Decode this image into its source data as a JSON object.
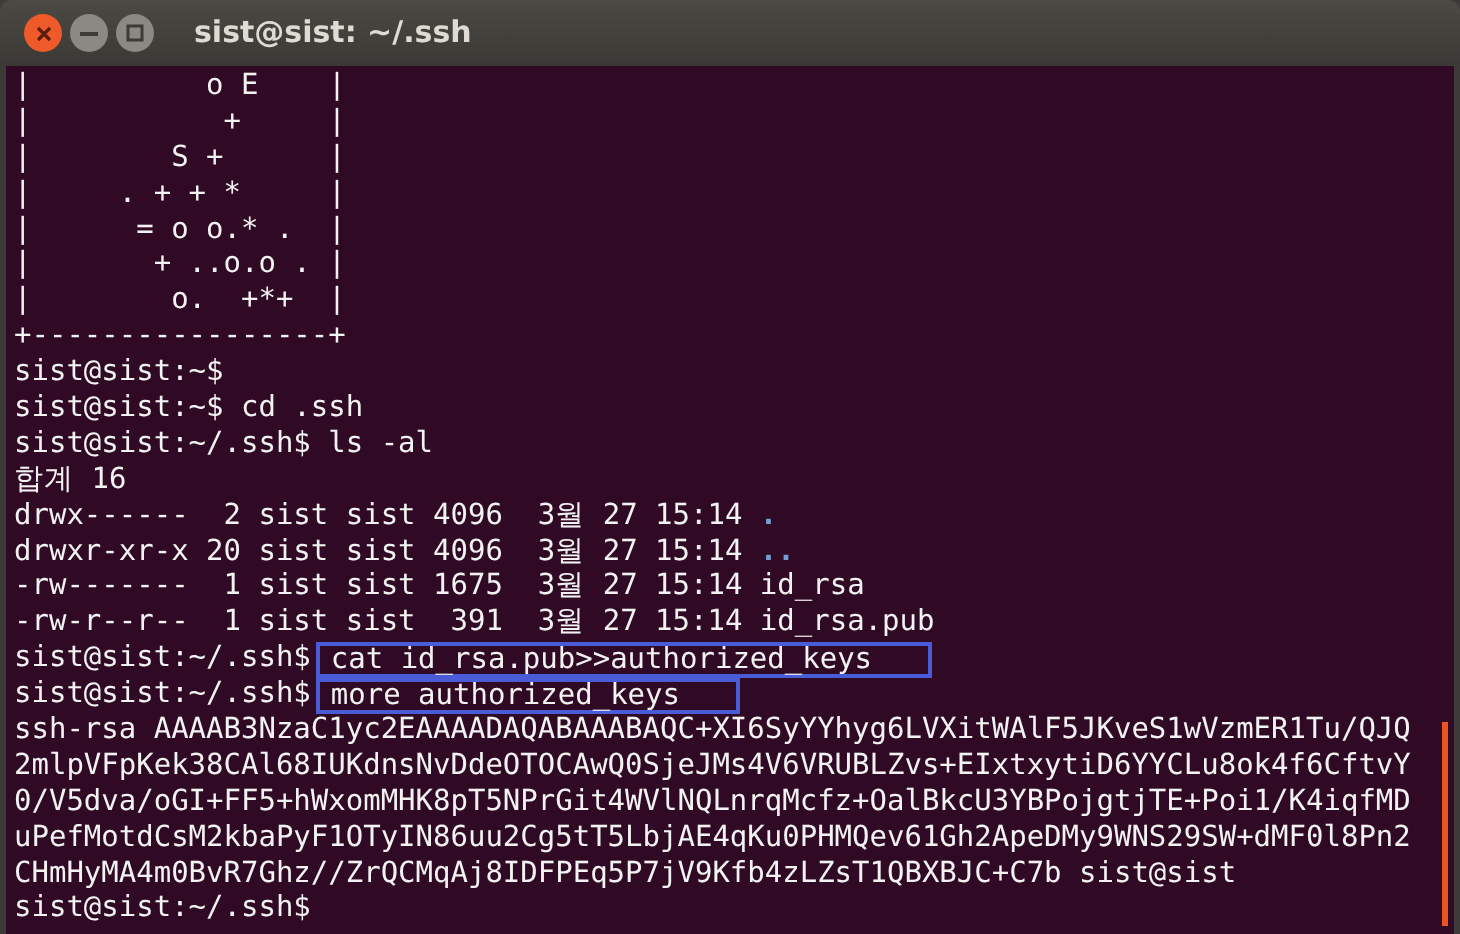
{
  "window": {
    "title": "sist@sist: ~/.ssh"
  },
  "terminal": {
    "lines": [
      {
        "kind": "text",
        "text": "|          o E    |"
      },
      {
        "kind": "text",
        "text": "|           +     |"
      },
      {
        "kind": "text",
        "text": "|        S +      |"
      },
      {
        "kind": "text",
        "text": "|     . + + *     |"
      },
      {
        "kind": "text",
        "text": "|      = o o.* .  |"
      },
      {
        "kind": "text",
        "text": "|       + ..o.o . |"
      },
      {
        "kind": "text",
        "text": "|        o.  +*+  |"
      },
      {
        "kind": "text",
        "text": "+-----------------+"
      },
      {
        "kind": "prompt",
        "prompt": "sist@sist:~$"
      },
      {
        "kind": "prompt",
        "prompt": "sist@sist:~$",
        "command": "cd .ssh",
        "highlighted": false
      },
      {
        "kind": "prompt",
        "prompt": "sist@sist:~/.ssh$",
        "command": "ls -al",
        "highlighted": false
      },
      {
        "kind": "text",
        "text": "합계 16"
      },
      {
        "kind": "ls",
        "info": "drwx------  2 sist sist 4096  3월 27 15:14",
        "name": ".",
        "is_dir": true
      },
      {
        "kind": "ls",
        "info": "drwxr-xr-x 20 sist sist 4096  3월 27 15:14",
        "name": "..",
        "is_dir": true
      },
      {
        "kind": "ls",
        "info": "-rw-------  1 sist sist 1675  3월 27 15:14",
        "name": "id_rsa",
        "is_dir": false
      },
      {
        "kind": "ls",
        "info": "-rw-r--r--  1 sist sist  391  3월 27 15:14",
        "name": "id_rsa.pub",
        "is_dir": false
      },
      {
        "kind": "prompt",
        "prompt": "sist@sist:~/.ssh$",
        "command": "cat id_rsa.pub>>authorized_keys",
        "highlighted": true
      },
      {
        "kind": "prompt",
        "prompt": "sist@sist:~/.ssh$",
        "command": "more authorized_keys",
        "highlighted": true
      },
      {
        "kind": "text",
        "text": "ssh-rsa AAAAB3NzaC1yc2EAAAADAQABAAABAQC+XI6SyYYhyg6LVXitWAlF5JKveS1wVzmER1Tu/QJQ"
      },
      {
        "kind": "text",
        "text": "2mlpVFpKek38CAl68IUKdnsNvDdeOTOCAwQ0SjeJMs4V6VRUBLZvs+EIxtxytiD6YYCLu8ok4f6CftvY"
      },
      {
        "kind": "text",
        "text": "0/V5dva/oGI+FF5+hWxomMHK8pT5NPrGit4WVlNQLnrqMcfz+OalBkcU3YBPojgtjTE+Poi1/K4iqfMD"
      },
      {
        "kind": "text",
        "text": "uPefMotdCsM2kbaPyF1OTyIN86uu2Cg5tT5LbjAE4qKu0PHMQev61Gh2ApeDMy9WNS29SW+dMF0l8Pn2"
      },
      {
        "kind": "text",
        "text": "CHmHyMA4m0BvR7Ghz//ZrQCMqAj8IDFPEq5P7jV9Kfb4zLZsT1QBXBJC+C7b sist@sist"
      },
      {
        "kind": "prompt",
        "prompt": "sist@sist:~/.ssh$"
      }
    ]
  }
}
